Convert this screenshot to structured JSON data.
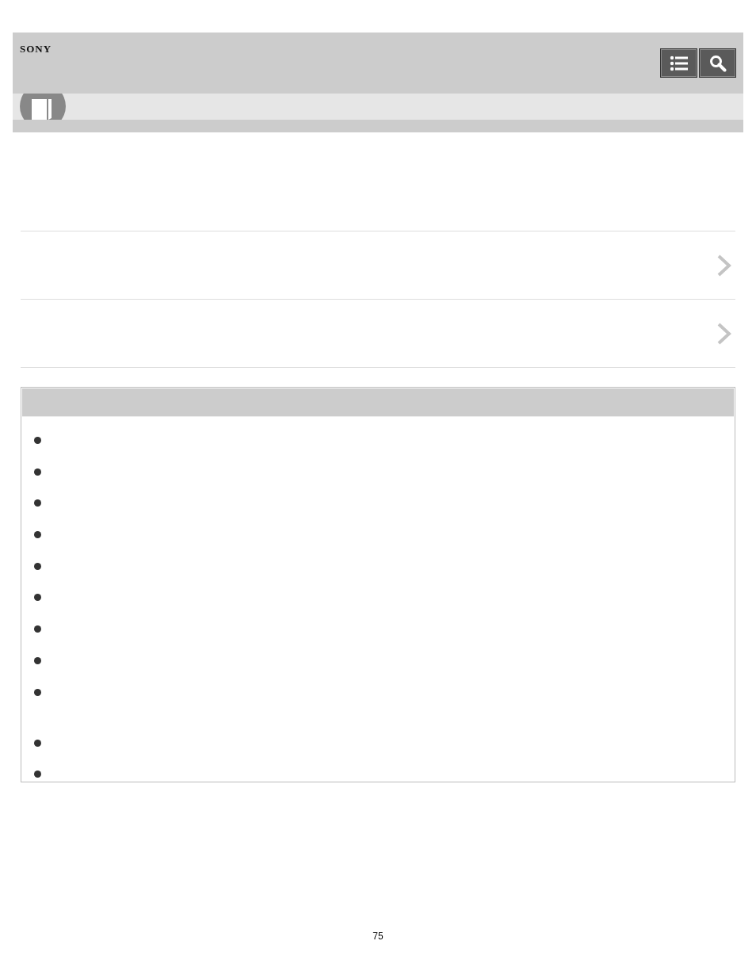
{
  "header": {
    "logo": "SONY"
  },
  "notes": [
    {
      "kind": "line"
    },
    {
      "kind": "line"
    },
    {
      "kind": "line"
    },
    {
      "kind": "line"
    },
    {
      "kind": "line"
    },
    {
      "kind": "line"
    },
    {
      "kind": "line"
    },
    {
      "kind": "line"
    },
    {
      "kind": "double"
    },
    {
      "kind": "line"
    },
    {
      "kind": "line"
    }
  ],
  "page_number": "75"
}
